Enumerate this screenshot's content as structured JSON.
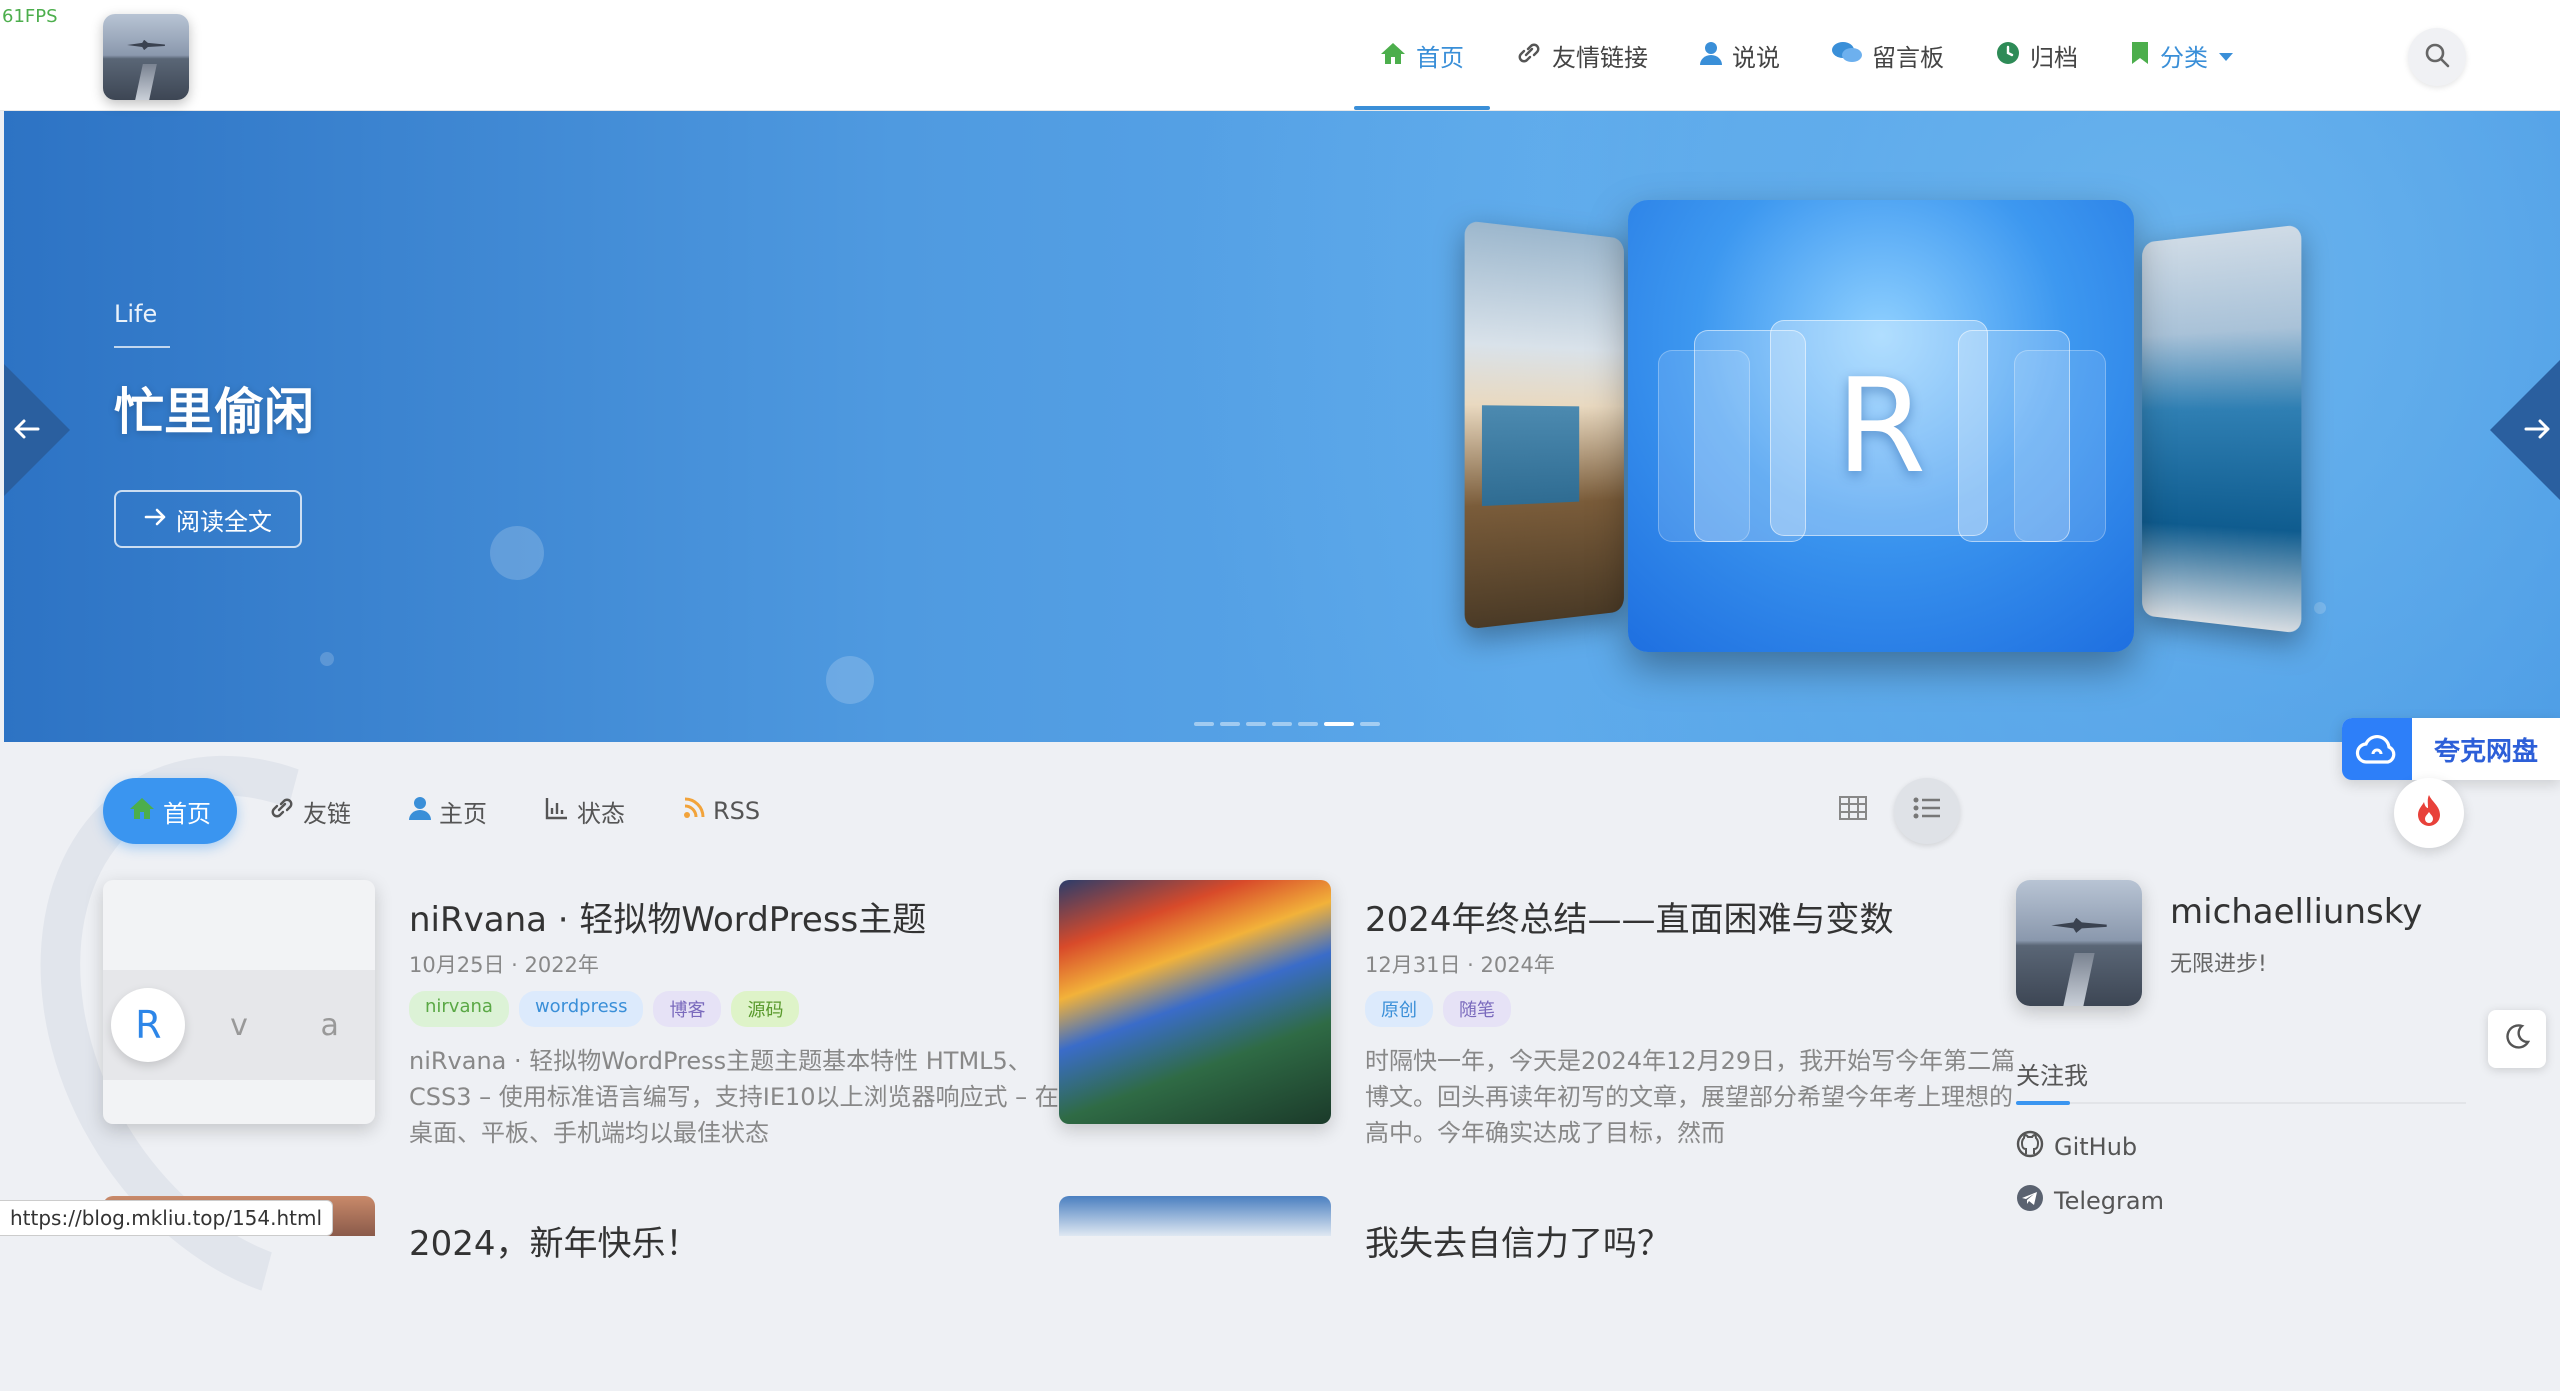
{
  "fps": "61FPS",
  "nav": {
    "items": [
      {
        "label": "首页",
        "icon": "home-icon"
      },
      {
        "label": "友情链接",
        "icon": "link-icon"
      },
      {
        "label": "说说",
        "icon": "user-icon"
      },
      {
        "label": "留言板",
        "icon": "comments-icon"
      },
      {
        "label": "归档",
        "icon": "clock-icon"
      },
      {
        "label": "分类",
        "icon": "bookmark-icon"
      }
    ],
    "active_index": 0
  },
  "hero": {
    "category": "Life",
    "title": "忙里偷闲",
    "button_label": "阅读全文",
    "slide_count": 7,
    "active_slide": 5,
    "center_card_letter": "R"
  },
  "widgets": {
    "quark_label": "夸克网盘"
  },
  "tabs": [
    {
      "label": "首页",
      "icon": "home-icon"
    },
    {
      "label": "友链",
      "icon": "link-icon"
    },
    {
      "label": "主页",
      "icon": "user-icon"
    },
    {
      "label": "状态",
      "icon": "chart-icon"
    },
    {
      "label": "RSS",
      "icon": "rss-icon"
    }
  ],
  "posts": [
    {
      "title": "niRvana · 轻拟物WordPress主题",
      "date": "10月25日 · 2022年",
      "tags": [
        {
          "label": "nirvana",
          "style": "green"
        },
        {
          "label": "wordpress",
          "style": "blue"
        },
        {
          "label": "博客",
          "style": "purple"
        },
        {
          "label": "源码",
          "style": "lgreen"
        }
      ],
      "excerpt": "niRvana · 轻拟物WordPress主题主题基本特性 HTML5、CSS3 – 使用标准语言编写，支持IE10以上浏览器响应式 – 在桌面、平板、手机端均以最佳状态",
      "thumb_letters": [
        "R",
        "v",
        "a"
      ]
    },
    {
      "title": "2024年终总结——直面困难与变数",
      "date": "12月31日 · 2024年",
      "tags": [
        {
          "label": "原创",
          "style": "blue"
        },
        {
          "label": "随笔",
          "style": "purple"
        }
      ],
      "excerpt": "时隔快一年，今天是2024年12月29日，我开始写今年第二篇博文。回头再读年初写的文章，展望部分希望今年考上理想的高中。今年确实达成了目标，然而"
    },
    {
      "title": "2024，新年快乐！"
    },
    {
      "title": "我失去自信力了吗？"
    }
  ],
  "sidebar": {
    "name": "michaelliunsky",
    "motto": "无限进步!",
    "follow_title": "关注我",
    "links": [
      {
        "label": "GitHub",
        "icon": "github-icon"
      },
      {
        "label": "Telegram",
        "icon": "telegram-icon"
      }
    ]
  },
  "status_url": "https://blog.mkliu.top/154.html",
  "colors": {
    "accent": "#3a95f0",
    "nav_active": "#3a8fd8",
    "home_icon": "#4cae4c"
  }
}
